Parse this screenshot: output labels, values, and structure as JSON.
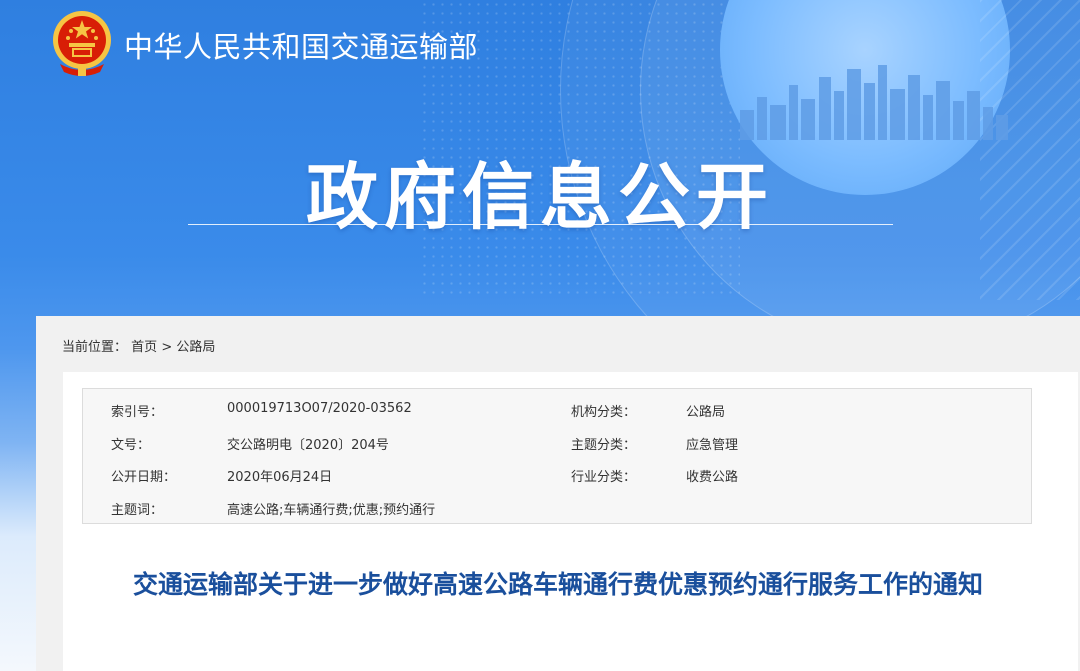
{
  "header": {
    "ministry_name": "中华人民共和国交通运输部",
    "section_title": "政府信息公开",
    "emblem_icon": "national-emblem-icon"
  },
  "breadcrumb": {
    "prefix": "当前位置：",
    "home": "首页",
    "separator": ">",
    "current": "公路局"
  },
  "meta": {
    "index_no_label": "索引号：",
    "index_no": "000019713O07/2020-03562",
    "org_label": "机构分类：",
    "org": "公路局",
    "doc_no_label": "文号：",
    "doc_no": "交公路明电〔2020〕204号",
    "topic_label": "主题分类：",
    "topic": "应急管理",
    "date_label": "公开日期：",
    "date": "2020年06月24日",
    "industry_label": "行业分类：",
    "industry": "收费公路",
    "keywords_label": "主题词：",
    "keywords": "高速公路;车辆通行费;优惠;预约通行"
  },
  "document": {
    "title": "交通运输部关于进一步做好高速公路车辆通行费优惠预约通行服务工作的通知"
  },
  "colors": {
    "banner_blue": "#3a8bea",
    "title_blue": "#1a4f9c",
    "emblem_red": "#d81e06",
    "emblem_gold": "#f6c544"
  }
}
